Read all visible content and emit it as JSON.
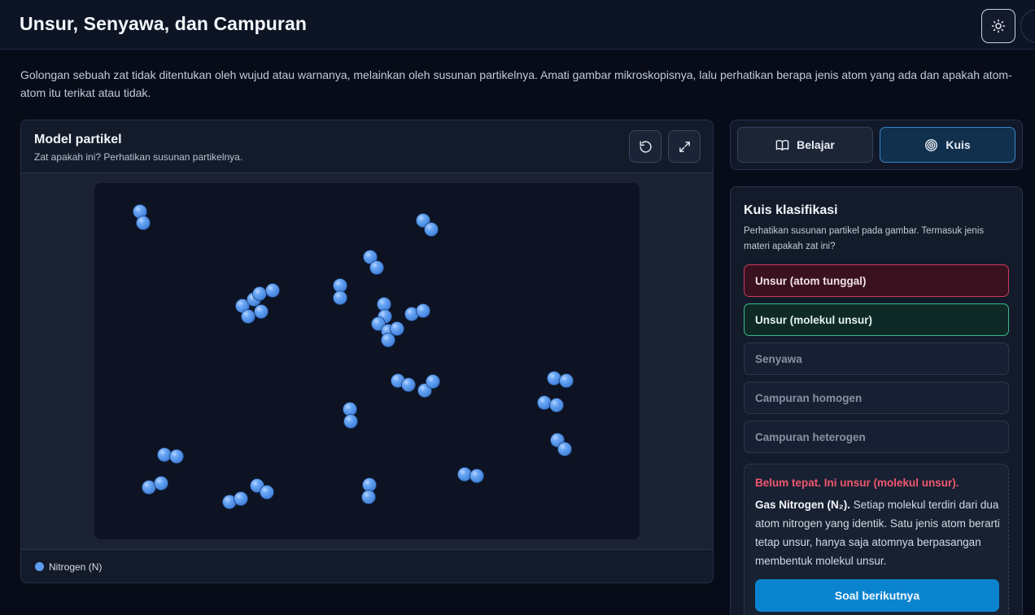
{
  "header": {
    "title": "Unsur, Senyawa, dan Campuran",
    "theme_icon": "sun-icon"
  },
  "intro": "Golongan sebuah zat tidak ditentukan oleh wujud atau warnanya, melainkan oleh susunan partikelnya. Amati gambar mikroskopisnya, lalu perhatikan berapa jenis atom yang ada dan apakah atom-atom itu terikat atau tidak.",
  "model": {
    "title": "Model partikel",
    "subtitle": "Zat apakah ini? Perhatikan susunan partikelnya.",
    "reset_icon": "reset-icon",
    "fullscreen_icon": "expand-icon",
    "atom_color": "#5c9cf2",
    "legend": [
      {
        "label": "Nitrogen (N)",
        "color": "#5c9cf2"
      }
    ]
  },
  "modes": {
    "learn_label": "Belajar",
    "learn_icon": "book-icon",
    "quiz_label": "Kuis",
    "quiz_icon": "target-icon",
    "active": "Kuis"
  },
  "quiz": {
    "title": "Kuis klasifikasi",
    "prompt": "Perhatikan susunan partikel pada gambar. Termasuk jenis materi apakah zat ini?",
    "options": [
      {
        "label": "Unsur (atom tunggal)",
        "state": "wrong"
      },
      {
        "label": "Unsur (molekul unsur)",
        "state": "correct"
      },
      {
        "label": "Senyawa",
        "state": "neutral"
      },
      {
        "label": "Campuran homogen",
        "state": "neutral"
      },
      {
        "label": "Campuran heterogen",
        "state": "neutral"
      }
    ],
    "feedback": {
      "verdict": "Belum tepat. Ini unsur (molekul unsur).",
      "substance": "Gas Nitrogen (N₂).",
      "explanation": "Setiap molekul terdiri dari dua atom nitrogen yang identik. Satu jenis atom berarti tetap unsur, hanya saja atomnya berpasangan membentuk molekul unsur."
    },
    "next_label": "Soal berikutnya"
  },
  "colors": {
    "accent": "#0b84cf",
    "wrong": "#c83b58",
    "correct": "#3bb98c",
    "nitrogen": "#5c9cf2"
  }
}
